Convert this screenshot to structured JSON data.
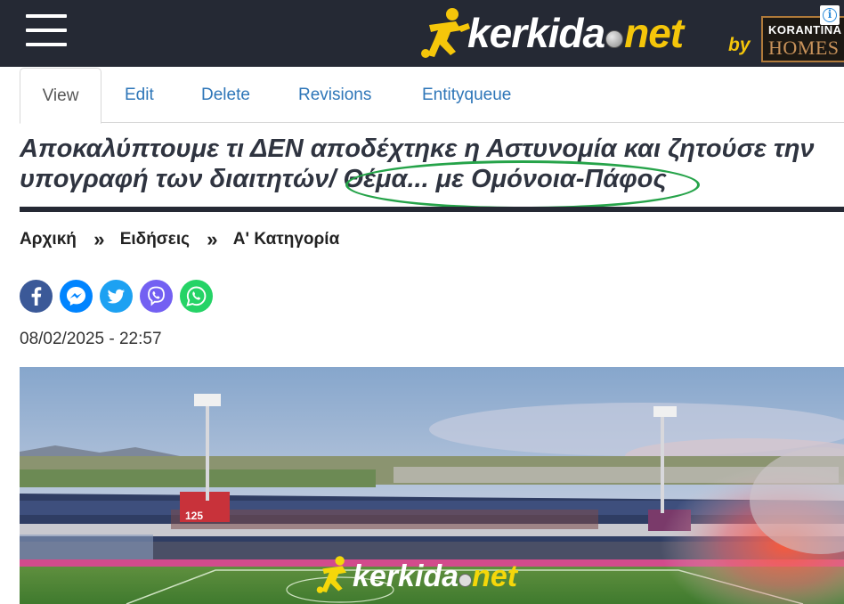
{
  "header": {
    "menu_icon": "hamburger-menu-icon",
    "logo": {
      "word_white": "kerkida",
      "word_yellow": "net",
      "by": "by"
    },
    "sponsor": {
      "line1": "KORANTINA",
      "line2": "HOMES"
    },
    "ad_info_icon": "info-icon",
    "colors": {
      "bar": "#252934",
      "brand_yellow": "#f5c60a"
    }
  },
  "tabs": [
    {
      "label": "View",
      "active": true
    },
    {
      "label": "Edit",
      "active": false
    },
    {
      "label": "Delete",
      "active": false
    },
    {
      "label": "Revisions",
      "active": false
    },
    {
      "label": "Entityqueue",
      "active": false
    }
  ],
  "article": {
    "title_line1": "Αποκαλύπτουμε τι ΔΕΝ αποδέχτηκε η Αστυνομία και ζητούσε την",
    "title_line2": "υπογραφή των διαιτητών/ Θέμα... με Ομόνοια-Πάφος",
    "highlight_color": "#25a349",
    "breadcrumb": [
      "Αρχική",
      "Ειδήσεις",
      "Α' Κατηγορία"
    ],
    "breadcrumb_separator": "»",
    "share": [
      {
        "name": "facebook",
        "icon": "facebook-icon",
        "color": "#3b5998"
      },
      {
        "name": "messenger",
        "icon": "messenger-icon",
        "color": "#0084ff"
      },
      {
        "name": "twitter",
        "icon": "twitter-icon",
        "color": "#1da1f2"
      },
      {
        "name": "viber",
        "icon": "viber-icon",
        "color": "#7360f2"
      },
      {
        "name": "whatsapp",
        "icon": "whatsapp-icon",
        "color": "#25d366"
      }
    ],
    "date": "08/02/2025 - 22:57",
    "image": {
      "watermark_white": "kerkida",
      "watermark_yellow": "net",
      "board_text": "125"
    }
  }
}
